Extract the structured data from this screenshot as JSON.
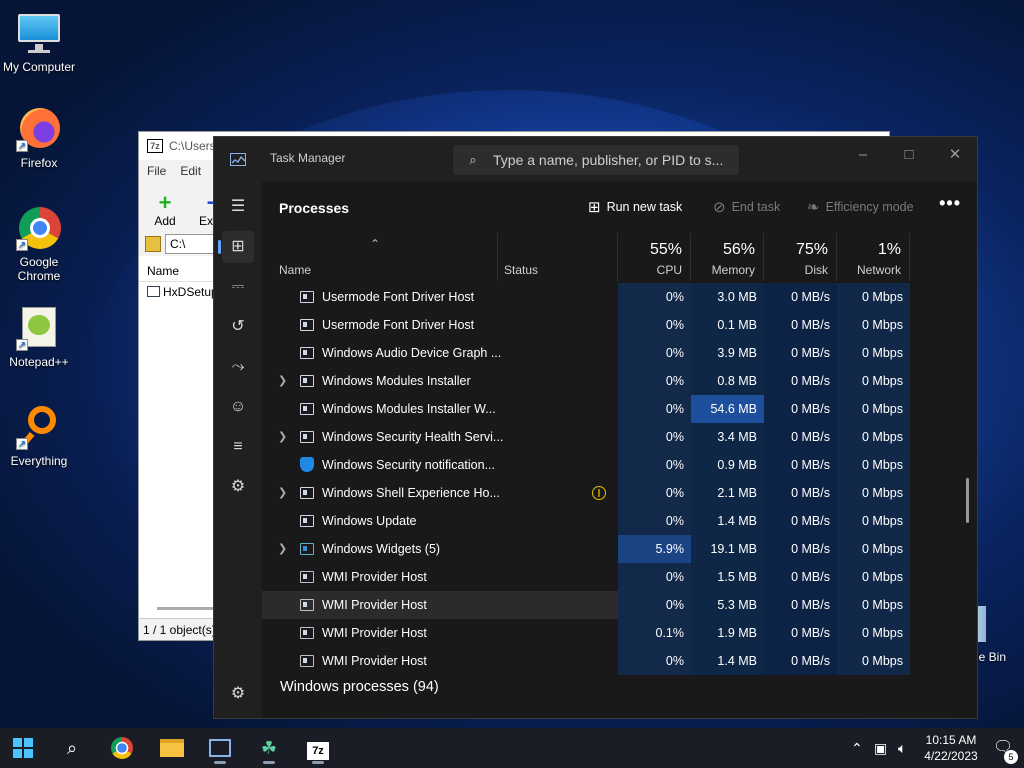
{
  "desktop": {
    "icons": [
      {
        "label": "My Computer",
        "icon": "monitor-icon"
      },
      {
        "label": "Firefox",
        "icon": "firefox-icon"
      },
      {
        "label": "Google Chrome",
        "icon": "chrome-icon"
      },
      {
        "label": "Notepad++",
        "icon": "notepadpp-icon"
      },
      {
        "label": "Everything",
        "icon": "everything-icon"
      }
    ],
    "recycle_bin_label": "le Bin"
  },
  "sevenzip": {
    "title": "C:\\Users",
    "logo": "7z",
    "menu": [
      "File",
      "Edit",
      "V"
    ],
    "toolbar": [
      {
        "label": "Add",
        "glyph": "+"
      },
      {
        "label": "Extra",
        "glyph": "−"
      }
    ],
    "address": "C:\\",
    "column_name": "Name",
    "file": "HxDSetup",
    "status": "1 / 1 object(s)"
  },
  "taskmanager": {
    "title": "Task Manager",
    "search_placeholder": "Type a name, publisher, or PID to s...",
    "heading": "Processes",
    "actions": {
      "run_new_task": "Run new task",
      "end_task": "End task",
      "efficiency_mode": "Efficiency mode",
      "more": "•••"
    },
    "columns": {
      "name": "Name",
      "status": "Status",
      "cpu": {
        "label": "CPU",
        "pct": "55%"
      },
      "memory": {
        "label": "Memory",
        "pct": "56%"
      },
      "disk": {
        "label": "Disk",
        "pct": "75%"
      },
      "network": {
        "label": "Network",
        "pct": "1%"
      }
    },
    "rows": [
      {
        "name": "Usermode Font Driver Host",
        "cpu": "0%",
        "mem": "3.0 MB",
        "disk": "0 MB/s",
        "net": "0 Mbps",
        "expandable": false,
        "icon": "app-window-icon"
      },
      {
        "name": "Usermode Font Driver Host",
        "cpu": "0%",
        "mem": "0.1 MB",
        "disk": "0 MB/s",
        "net": "0 Mbps",
        "expandable": false,
        "icon": "app-window-icon"
      },
      {
        "name": "Windows Audio Device Graph ...",
        "cpu": "0%",
        "mem": "3.9 MB",
        "disk": "0 MB/s",
        "net": "0 Mbps",
        "expandable": false,
        "icon": "app-window-icon"
      },
      {
        "name": "Windows Modules Installer",
        "cpu": "0%",
        "mem": "0.8 MB",
        "disk": "0 MB/s",
        "net": "0 Mbps",
        "expandable": true,
        "icon": "app-window-icon"
      },
      {
        "name": "Windows Modules Installer W...",
        "cpu": "0%",
        "mem": "54.6 MB",
        "disk": "0 MB/s",
        "net": "0 Mbps",
        "expandable": false,
        "icon": "app-window-icon",
        "mem_hi": true
      },
      {
        "name": "Windows Security Health Servi...",
        "cpu": "0%",
        "mem": "3.4 MB",
        "disk": "0 MB/s",
        "net": "0 Mbps",
        "expandable": true,
        "icon": "app-window-icon"
      },
      {
        "name": "Windows Security notification...",
        "cpu": "0%",
        "mem": "0.9 MB",
        "disk": "0 MB/s",
        "net": "0 Mbps",
        "expandable": false,
        "icon": "shield-icon"
      },
      {
        "name": "Windows Shell Experience Ho...",
        "cpu": "0%",
        "mem": "2.1 MB",
        "disk": "0 MB/s",
        "net": "0 Mbps",
        "expandable": true,
        "icon": "app-window-icon",
        "suspended": true
      },
      {
        "name": "Windows Update",
        "cpu": "0%",
        "mem": "1.4 MB",
        "disk": "0 MB/s",
        "net": "0 Mbps",
        "expandable": false,
        "icon": "app-window-icon"
      },
      {
        "name": "Windows Widgets (5)",
        "cpu": "5.9%",
        "mem": "19.1 MB",
        "disk": "0 MB/s",
        "net": "0 Mbps",
        "expandable": true,
        "icon": "widgets-icon",
        "cpu_hi": true
      },
      {
        "name": "WMI Provider Host",
        "cpu": "0%",
        "mem": "1.5 MB",
        "disk": "0 MB/s",
        "net": "0 Mbps",
        "expandable": false,
        "icon": "wmi-icon"
      },
      {
        "name": "WMI Provider Host",
        "cpu": "0%",
        "mem": "5.3 MB",
        "disk": "0 MB/s",
        "net": "0 Mbps",
        "expandable": false,
        "icon": "wmi-icon",
        "hover": true
      },
      {
        "name": "WMI Provider Host",
        "cpu": "0.1%",
        "mem": "1.9 MB",
        "disk": "0 MB/s",
        "net": "0 Mbps",
        "expandable": false,
        "icon": "wmi-icon"
      },
      {
        "name": "WMI Provider Host",
        "cpu": "0%",
        "mem": "1.4 MB",
        "disk": "0 MB/s",
        "net": "0 Mbps",
        "expandable": false,
        "icon": "wmi-icon"
      }
    ],
    "group_header": "Windows processes (94)",
    "colors": {
      "cpu_bg": "#13294a",
      "mem_bg": "#0f2747",
      "disk_bg": "#0c2346",
      "net_bg": "#112848",
      "mem_hi_bg": "#1d4f9c",
      "cpu_hi_bg": "#1a4384",
      "accent": "#60a5ff"
    }
  },
  "taskbar": {
    "clock_time": "10:15 AM",
    "clock_date": "4/22/2023",
    "notification_count": "5"
  }
}
